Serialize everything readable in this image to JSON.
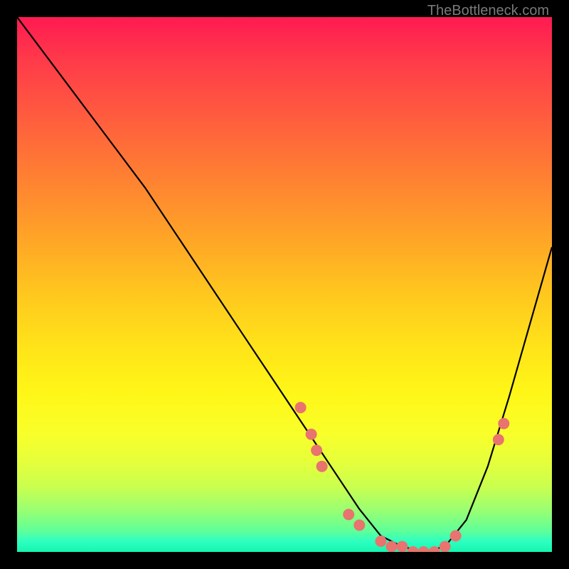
{
  "watermark": "TheBottleneck.com",
  "chart_data": {
    "type": "line",
    "title": "",
    "xlabel": "",
    "ylabel": "",
    "xlim": [
      0,
      100
    ],
    "ylim": [
      0,
      100
    ],
    "series": [
      {
        "name": "bottleneck-curve",
        "x": [
          0,
          6,
          12,
          18,
          24,
          30,
          36,
          42,
          48,
          54,
          60,
          64,
          68,
          72,
          76,
          80,
          84,
          88,
          92,
          96,
          100
        ],
        "values": [
          100,
          92,
          84,
          76,
          68,
          59,
          50,
          41,
          32,
          23,
          14,
          8,
          3,
          1,
          0,
          1,
          6,
          16,
          29,
          43,
          57
        ]
      }
    ],
    "markers": {
      "name": "highlighted-points",
      "color": "#e9736e",
      "points": [
        {
          "x": 53,
          "y": 27
        },
        {
          "x": 55,
          "y": 22
        },
        {
          "x": 56,
          "y": 19
        },
        {
          "x": 57,
          "y": 16
        },
        {
          "x": 62,
          "y": 7
        },
        {
          "x": 64,
          "y": 5
        },
        {
          "x": 68,
          "y": 2
        },
        {
          "x": 70,
          "y": 1
        },
        {
          "x": 72,
          "y": 1
        },
        {
          "x": 74,
          "y": 0
        },
        {
          "x": 76,
          "y": 0
        },
        {
          "x": 78,
          "y": 0
        },
        {
          "x": 80,
          "y": 1
        },
        {
          "x": 82,
          "y": 3
        },
        {
          "x": 90,
          "y": 21
        },
        {
          "x": 91,
          "y": 24
        }
      ]
    },
    "background": {
      "type": "vertical-gradient",
      "stops": [
        {
          "pos": 0,
          "color": "#ff1a52"
        },
        {
          "pos": 50,
          "color": "#ffc81e"
        },
        {
          "pos": 80,
          "color": "#f8ff2a"
        },
        {
          "pos": 100,
          "color": "#15f6b0"
        }
      ]
    }
  }
}
